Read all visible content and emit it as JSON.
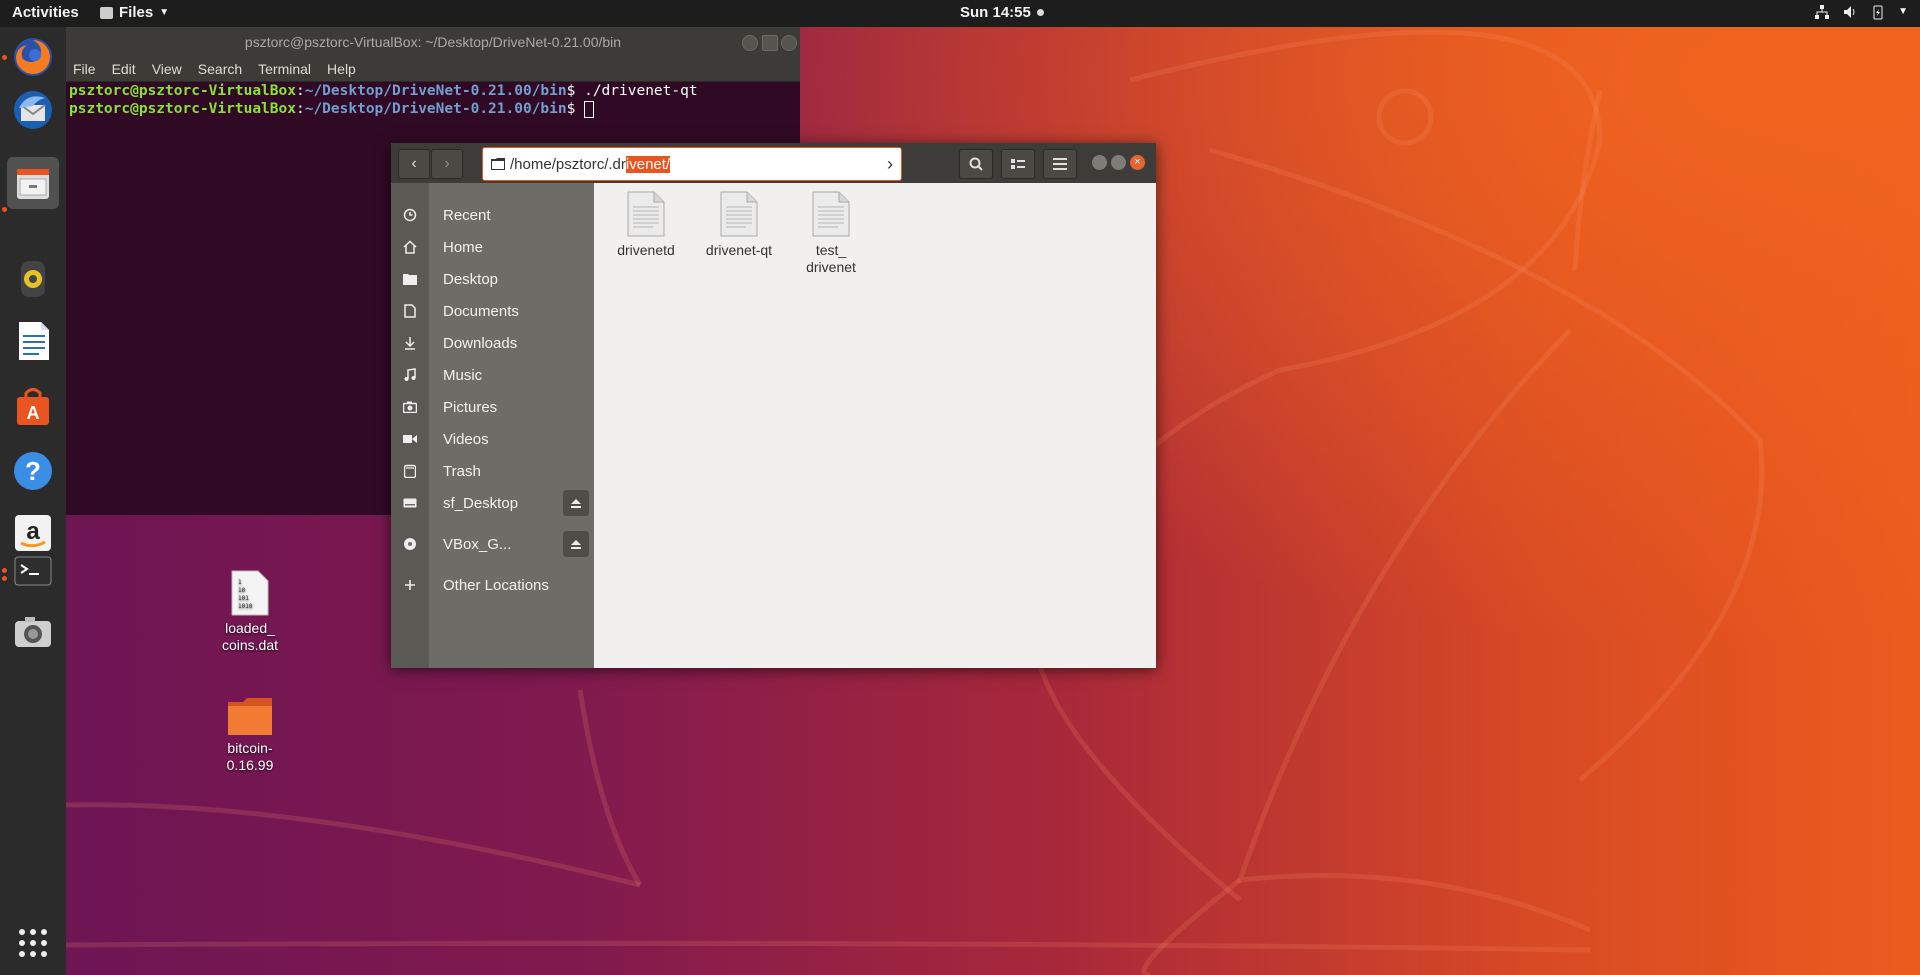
{
  "topbar": {
    "activities": "Activities",
    "app_menu": "Files",
    "clock": "Sun 14:55"
  },
  "dock": {
    "apps": [
      "Firefox",
      "Thunderbird",
      "Files",
      "Rhythmbox",
      "LibreOffice Writer",
      "Ubuntu Software",
      "Help",
      "Amazon",
      "Terminal",
      "Screenshot"
    ]
  },
  "terminal": {
    "title": "psztorc@psztorc-VirtualBox: ~/Desktop/DriveNet-0.21.00/bin",
    "menu": [
      "File",
      "Edit",
      "View",
      "Search",
      "Terminal",
      "Help"
    ],
    "user": "psztorc@psztorc-VirtualBox",
    "path": "~/Desktop/DriveNet-0.21.00/bin",
    "cmd1": " ./drivenet-qt",
    "prompt_sep": ":",
    "prompt_end": "$"
  },
  "files": {
    "path_prefix": "/home/psztorc/.dr",
    "path_selected": "ivenet/",
    "sidebar": [
      {
        "label": "Recent",
        "icon": "clock-icon"
      },
      {
        "label": "Home",
        "icon": "home-icon"
      },
      {
        "label": "Desktop",
        "icon": "folder-icon"
      },
      {
        "label": "Documents",
        "icon": "document-icon"
      },
      {
        "label": "Downloads",
        "icon": "download-icon"
      },
      {
        "label": "Music",
        "icon": "music-icon"
      },
      {
        "label": "Pictures",
        "icon": "camera-icon"
      },
      {
        "label": "Videos",
        "icon": "video-icon"
      },
      {
        "label": "Trash",
        "icon": "trash-icon"
      },
      {
        "label": "sf_Desktop",
        "icon": "drive-icon"
      },
      {
        "label": "VBox_G...",
        "icon": "disc-icon"
      },
      {
        "label": "Other Locations",
        "icon": "plus-icon"
      }
    ],
    "items": [
      {
        "line1": "drivenetd",
        "line2": ""
      },
      {
        "line1": "drivenet-qt",
        "line2": ""
      },
      {
        "line1": "test_",
        "line2": "drivenet"
      }
    ]
  },
  "desktop_icons": [
    {
      "line1": "loaded_",
      "line2": "coins.dat",
      "badge": "1\n10\n101\n1010"
    },
    {
      "line1": "bitcoin-",
      "line2": "0.16.99"
    }
  ]
}
